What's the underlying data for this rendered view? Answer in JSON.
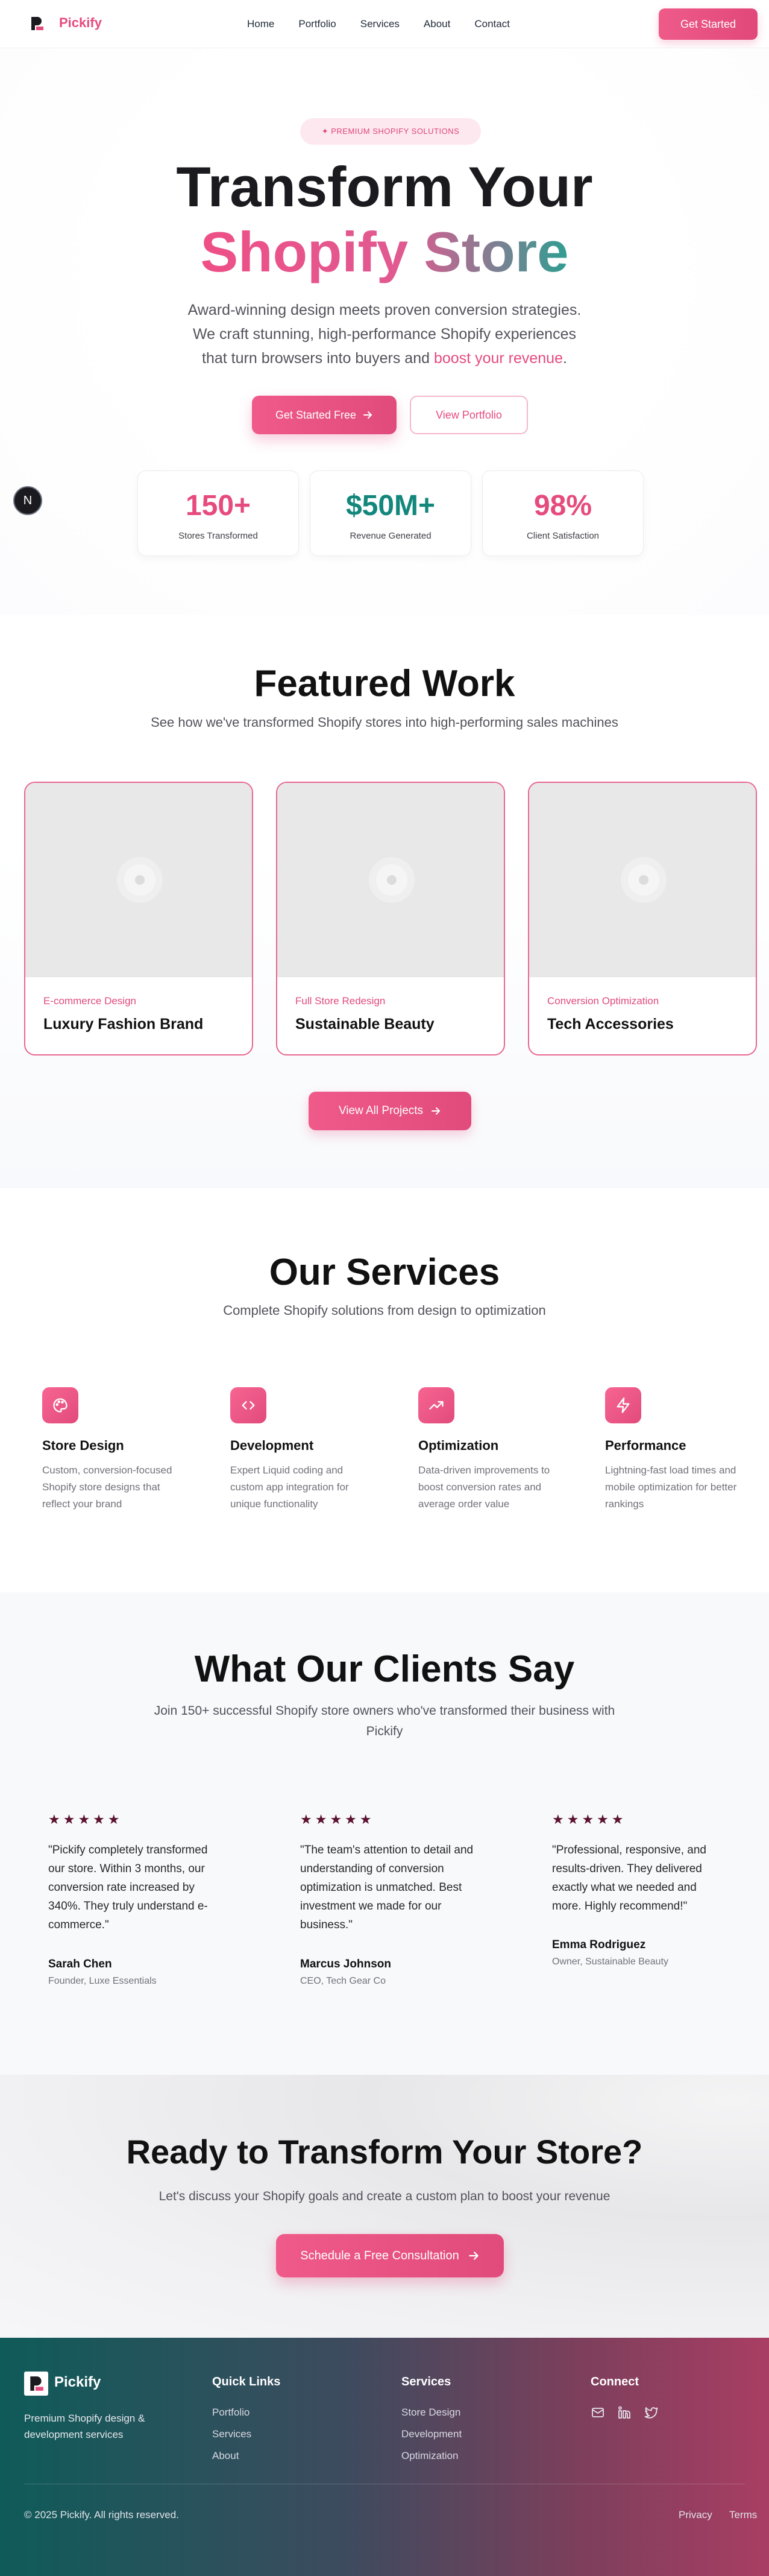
{
  "nav": {
    "brand": "Pickify",
    "links": [
      "Home",
      "Portfolio",
      "Services",
      "About",
      "Contact"
    ],
    "cta": "Get Started"
  },
  "hero": {
    "pill": "✦ PREMIUM SHOPIFY SOLUTIONS",
    "title_line1": "Transform Your",
    "title_line2": "Shopify Store",
    "subtitle_line1": "Award-winning design meets proven conversion strategies.",
    "subtitle_line2": "We craft stunning, high-performance Shopify experiences",
    "subtitle_line3_pre": "that turn browsers into buyers and ",
    "subtitle_line3_em": "boost your revenue",
    "subtitle_line3_post": ".",
    "primary_button": "Get Started Free",
    "secondary_button": "View Portfolio",
    "floating_badge": "N",
    "stats": [
      {
        "value": "150+",
        "label": "Stores Transformed",
        "color": "#e64b7e"
      },
      {
        "value": "$50M+",
        "label": "Revenue Generated",
        "color": "#13877c"
      },
      {
        "value": "98%",
        "label": "Client Satisfaction",
        "color": "#e64b7e"
      }
    ]
  },
  "featured": {
    "title": "Featured Work",
    "subtitle": "See how we've transformed Shopify stores into high-performing sales machines",
    "projects": [
      {
        "category": "E-commerce Design",
        "title": "Luxury Fashion Brand"
      },
      {
        "category": "Full Store Redesign",
        "title": "Sustainable Beauty"
      },
      {
        "category": "Conversion Optimization",
        "title": "Tech Accessories"
      }
    ],
    "view_all": "View All Projects"
  },
  "services": {
    "title": "Our Services",
    "subtitle": "Complete Shopify solutions from design to optimization",
    "items": [
      {
        "icon": "palette-icon",
        "title": "Store Design",
        "desc": "Custom, conversion-focused Shopify store designs that reflect your brand"
      },
      {
        "icon": "code-icon",
        "title": "Development",
        "desc": "Expert Liquid coding and custom app integration for unique functionality"
      },
      {
        "icon": "trending-up-icon",
        "title": "Optimization",
        "desc": "Data-driven improvements to boost conversion rates and average order value"
      },
      {
        "icon": "lightning-icon",
        "title": "Performance",
        "desc": "Lightning-fast load times and mobile optimization for better rankings"
      }
    ]
  },
  "testimonials": {
    "title": "What Our Clients Say",
    "subtitle_line1": "Join 150+ successful Shopify store owners who've transformed their business with",
    "subtitle_line2": "Pickify",
    "stars": "★★★★★",
    "items": [
      {
        "quote": "\"Pickify completely transformed our store. Within 3 months, our conversion rate increased by 340%. They truly understand e-commerce.\"",
        "name": "Sarah Chen",
        "role": "Founder, Luxe Essentials"
      },
      {
        "quote": "\"The team's attention to detail and understanding of conversion optimization is unmatched. Best investment we made for our business.\"",
        "name": "Marcus Johnson",
        "role": "CEO, Tech Gear Co"
      },
      {
        "quote": "\"Professional, responsive, and results-driven. They delivered exactly what we needed and more. Highly recommend!\"",
        "name": "Emma Rodriguez",
        "role": "Owner, Sustainable Beauty"
      }
    ]
  },
  "cta": {
    "title": "Ready to Transform Your Store?",
    "subtitle": "Let's discuss your Shopify goals and create a custom plan to boost your revenue",
    "button": "Schedule a Free Consultation"
  },
  "footer": {
    "brand": "Pickify",
    "tagline": "Premium Shopify design & development services",
    "quick_links_title": "Quick Links",
    "quick_links": [
      "Portfolio",
      "Services",
      "About"
    ],
    "services_title": "Services",
    "services_links": [
      "Store Design",
      "Development",
      "Optimization"
    ],
    "connect_title": "Connect",
    "copyright": "© 2025 Pickify. All rights reserved.",
    "privacy": "Privacy",
    "terms": "Terms"
  }
}
